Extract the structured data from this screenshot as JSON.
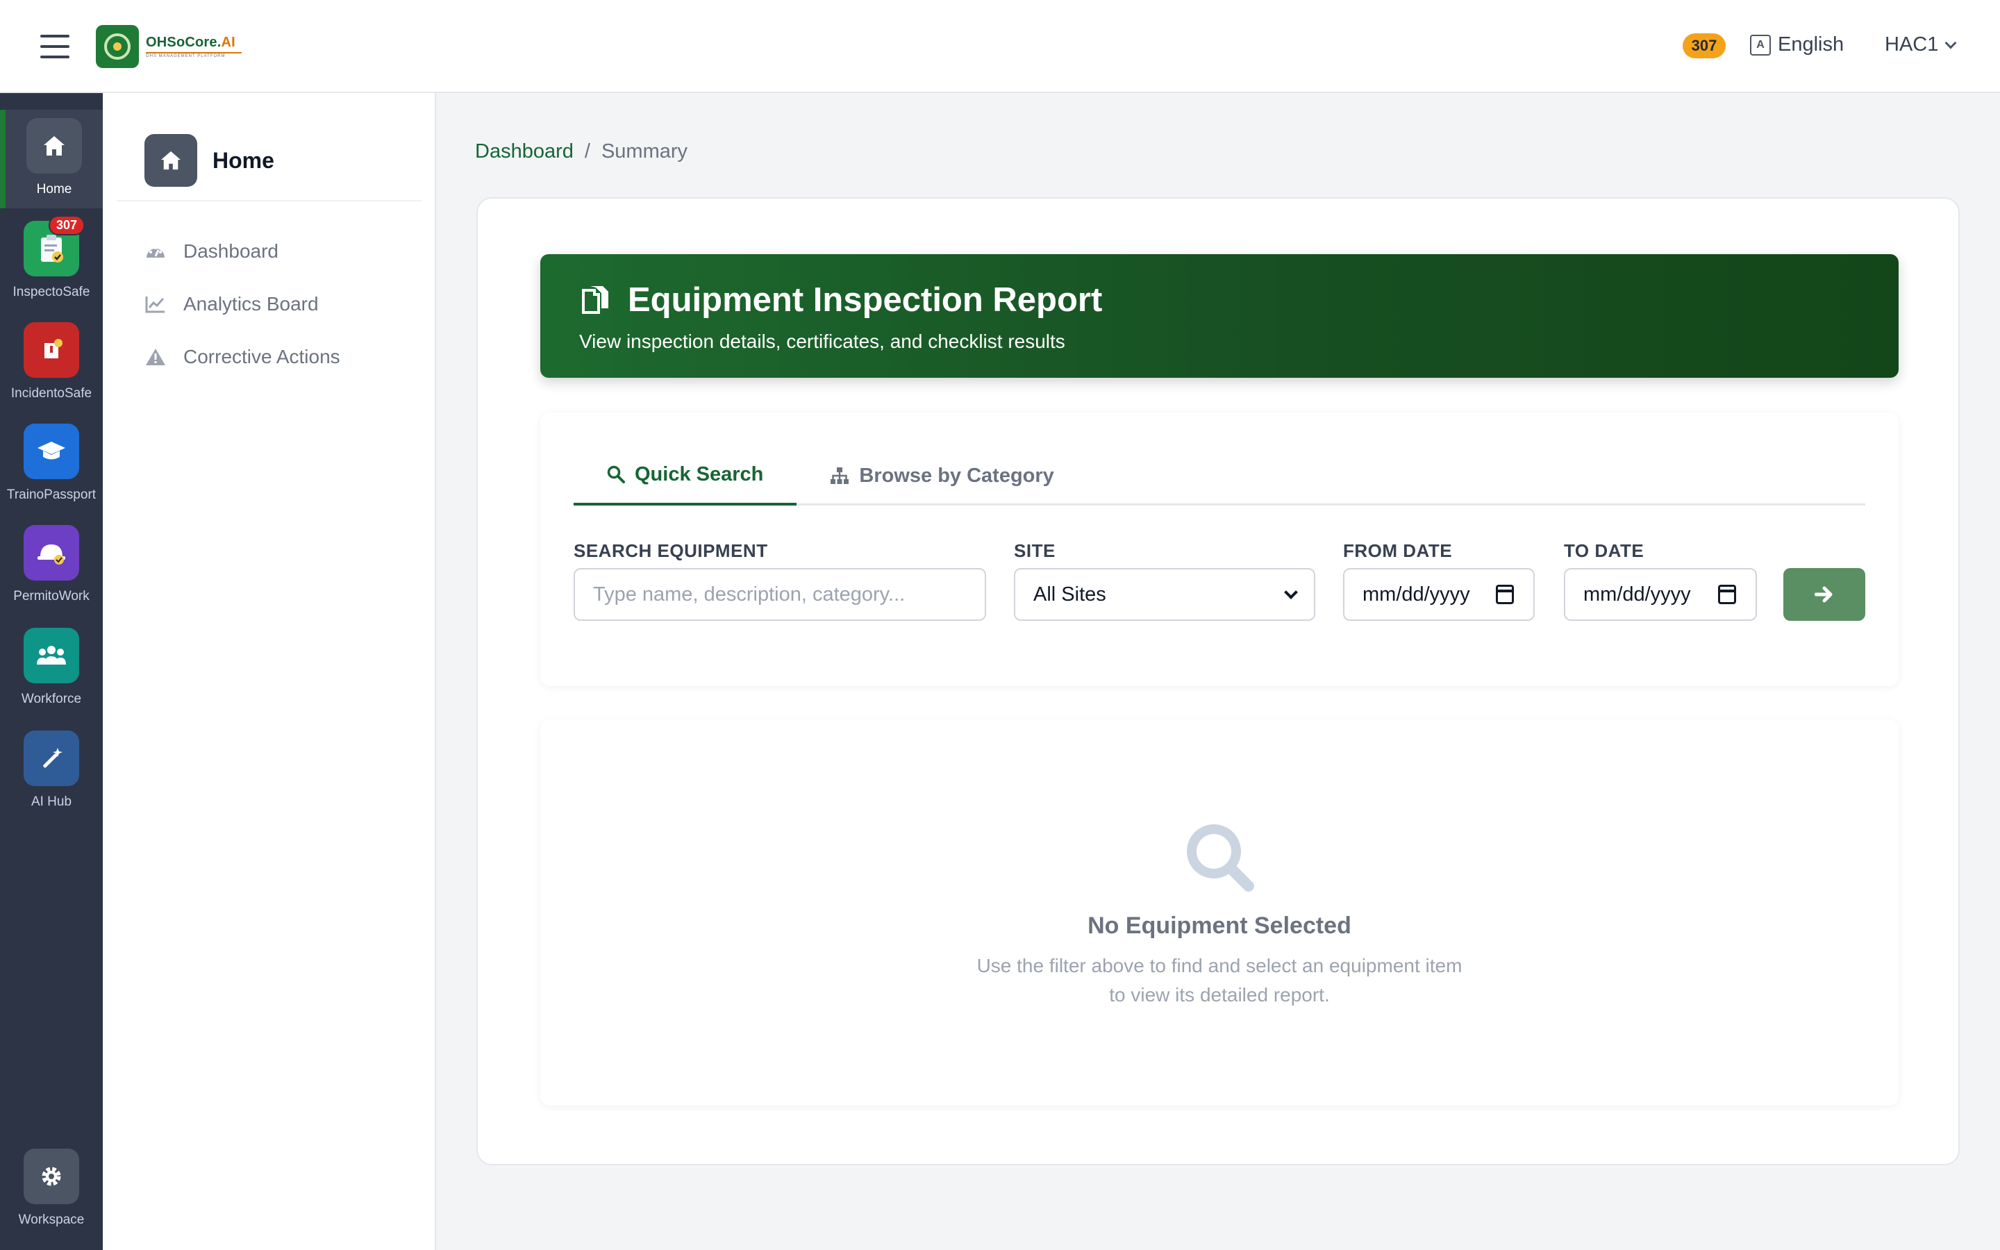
{
  "header": {
    "logo": {
      "name_main": "OHSoCore.",
      "name_ai": "AI",
      "tagline": "OHS MANAGEMENT PLATFORM"
    },
    "notification_count": "307",
    "language": "English",
    "user": "HAC1"
  },
  "rail": {
    "items": [
      {
        "label": "Home",
        "icon": "home-icon",
        "color": "#4b5563",
        "active": true
      },
      {
        "label": "InspectoSafe",
        "icon": "clipboard-check-icon",
        "color": "#22a35a",
        "badge": "307"
      },
      {
        "label": "IncidentoSafe",
        "icon": "incident-icon",
        "color": "#c62828"
      },
      {
        "label": "TrainoPassport",
        "icon": "graduation-cap-icon",
        "color": "#1e6fd9"
      },
      {
        "label": "PermitoWork",
        "icon": "hard-hat-icon",
        "color": "#6d3fc4"
      },
      {
        "label": "Workforce",
        "icon": "users-icon",
        "color": "#0f9488"
      },
      {
        "label": "AI Hub",
        "icon": "magic-wand-icon",
        "color": "#2f5c96"
      }
    ],
    "footer": {
      "label": "Workspace",
      "icon": "gear-icon",
      "color": "#4b5563"
    }
  },
  "sidebar": {
    "title": "Home",
    "items": [
      {
        "label": "Dashboard",
        "icon": "gauge-icon"
      },
      {
        "label": "Analytics Board",
        "icon": "chart-line-icon"
      },
      {
        "label": "Corrective Actions",
        "icon": "warning-icon"
      }
    ]
  },
  "breadcrumb": {
    "root": "Dashboard",
    "separator": "/",
    "current": "Summary"
  },
  "banner": {
    "title": "Equipment Inspection Report",
    "subtitle": "View inspection details, certificates, and checklist results"
  },
  "tabs": [
    {
      "label": "Quick Search",
      "icon": "search-icon",
      "active": true
    },
    {
      "label": "Browse by Category",
      "icon": "sitemap-icon",
      "active": false
    }
  ],
  "filters": {
    "search": {
      "label": "SEARCH EQUIPMENT",
      "placeholder": "Type name, description, category..."
    },
    "site": {
      "label": "SITE",
      "value": "All Sites"
    },
    "from_date": {
      "label": "FROM DATE",
      "placeholder": "mm/dd/yyyy"
    },
    "to_date": {
      "label": "TO DATE",
      "placeholder": "mm/dd/yyyy"
    }
  },
  "empty_state": {
    "title": "No Equipment Selected",
    "line1": "Use the filter above to find and select an equipment item",
    "line2": "to view its detailed report."
  },
  "colors": {
    "brand_green": "#166534",
    "badge_orange": "#f5a21b",
    "rail_bg": "#2d3446"
  }
}
